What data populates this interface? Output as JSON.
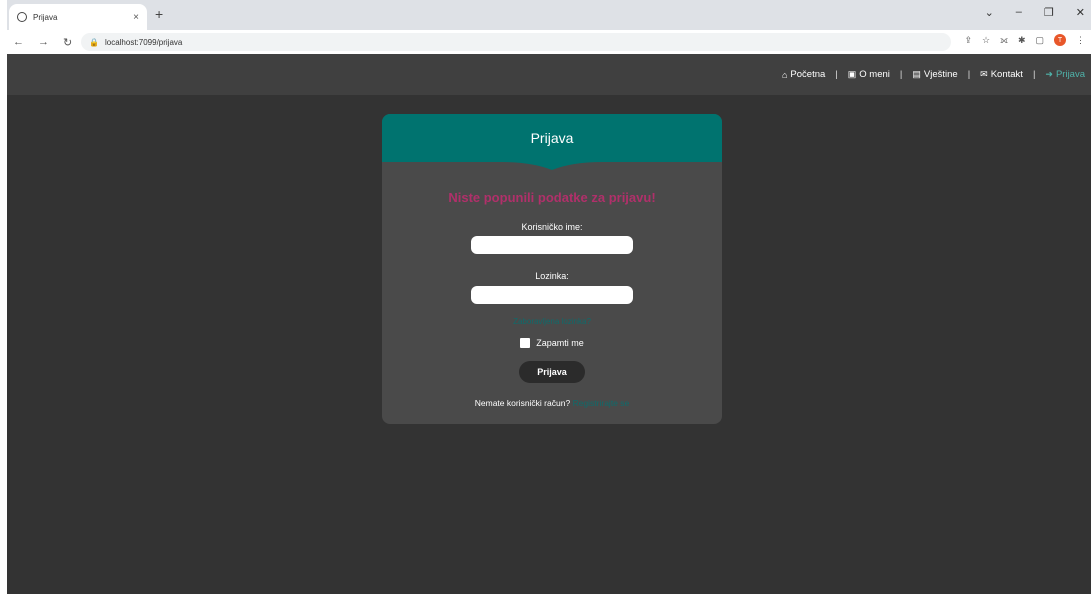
{
  "browser": {
    "tab_title": "Prijava",
    "new_tab": "+",
    "close_tab": "×",
    "url": "localhost:7099/prijava",
    "window_controls": [
      "⌄",
      "–",
      "❐",
      "✕"
    ],
    "avatar_letter": "T"
  },
  "navbar": {
    "items": [
      {
        "label": "Početna",
        "icon": "home-icon"
      },
      {
        "label": "O meni",
        "icon": "id-card-icon"
      },
      {
        "label": "Vještine",
        "icon": "book-icon"
      },
      {
        "label": "Kontakt",
        "icon": "envelope-icon"
      },
      {
        "label": "Prijava",
        "icon": "sign-in-icon"
      }
    ],
    "separator": "|"
  },
  "card": {
    "title": "Prijava",
    "error": "Niste popunili podatke za prijavu!",
    "username_label": "Korisničko ime:",
    "username_value": "",
    "password_label": "Lozinka:",
    "password_value": "",
    "forgot": "Zaboravljena lozinka?",
    "remember": "Zapamti me",
    "submit": "Prijava",
    "signup_text": "Nemate korisnički račun?",
    "signup_link": "Registrirajte se"
  },
  "colors": {
    "accent": "#00736f",
    "error": "#b0306a",
    "nav_active": "#4fb3aa"
  }
}
